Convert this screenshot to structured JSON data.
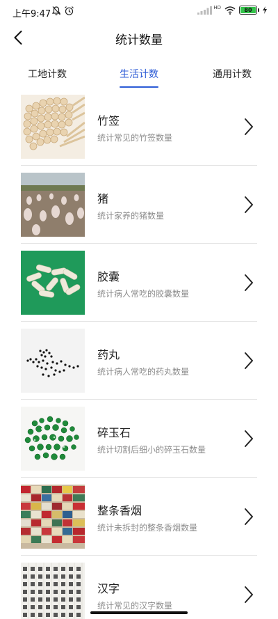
{
  "status_bar": {
    "time": "上午9:47",
    "network_label": "HD",
    "battery_level": "80",
    "icons": [
      "mute-icon",
      "alarm-icon",
      "signal-icon",
      "wifi-icon",
      "battery-icon",
      "charging-icon"
    ]
  },
  "header": {
    "title": "统计数量",
    "back_icon": "chevron-left-icon"
  },
  "tabs": [
    {
      "label": "工地计数",
      "active": false
    },
    {
      "label": "生活计数",
      "active": true
    },
    {
      "label": "通用计数",
      "active": false
    }
  ],
  "accent_color": "#2c5bd6",
  "items": [
    {
      "title": "竹签",
      "subtitle": "统计常见的竹签数量",
      "image": "bamboo-sticks-image"
    },
    {
      "title": "猪",
      "subtitle": "统计家养的猪数量",
      "image": "pigs-image"
    },
    {
      "title": "胶囊",
      "subtitle": "统计病人常吃的胶囊数量",
      "image": "capsules-image"
    },
    {
      "title": "药丸",
      "subtitle": "统计病人常吃的药丸数量",
      "image": "pills-image"
    },
    {
      "title": "碎玉石",
      "subtitle": "统计切割后细小的碎玉石数量",
      "image": "jade-pieces-image"
    },
    {
      "title": "整条香烟",
      "subtitle": "统计未拆封的整条香烟数量",
      "image": "cigarette-cartons-image"
    },
    {
      "title": "汉字",
      "subtitle": "统计常见的汉字数量",
      "image": "chinese-characters-image"
    }
  ]
}
